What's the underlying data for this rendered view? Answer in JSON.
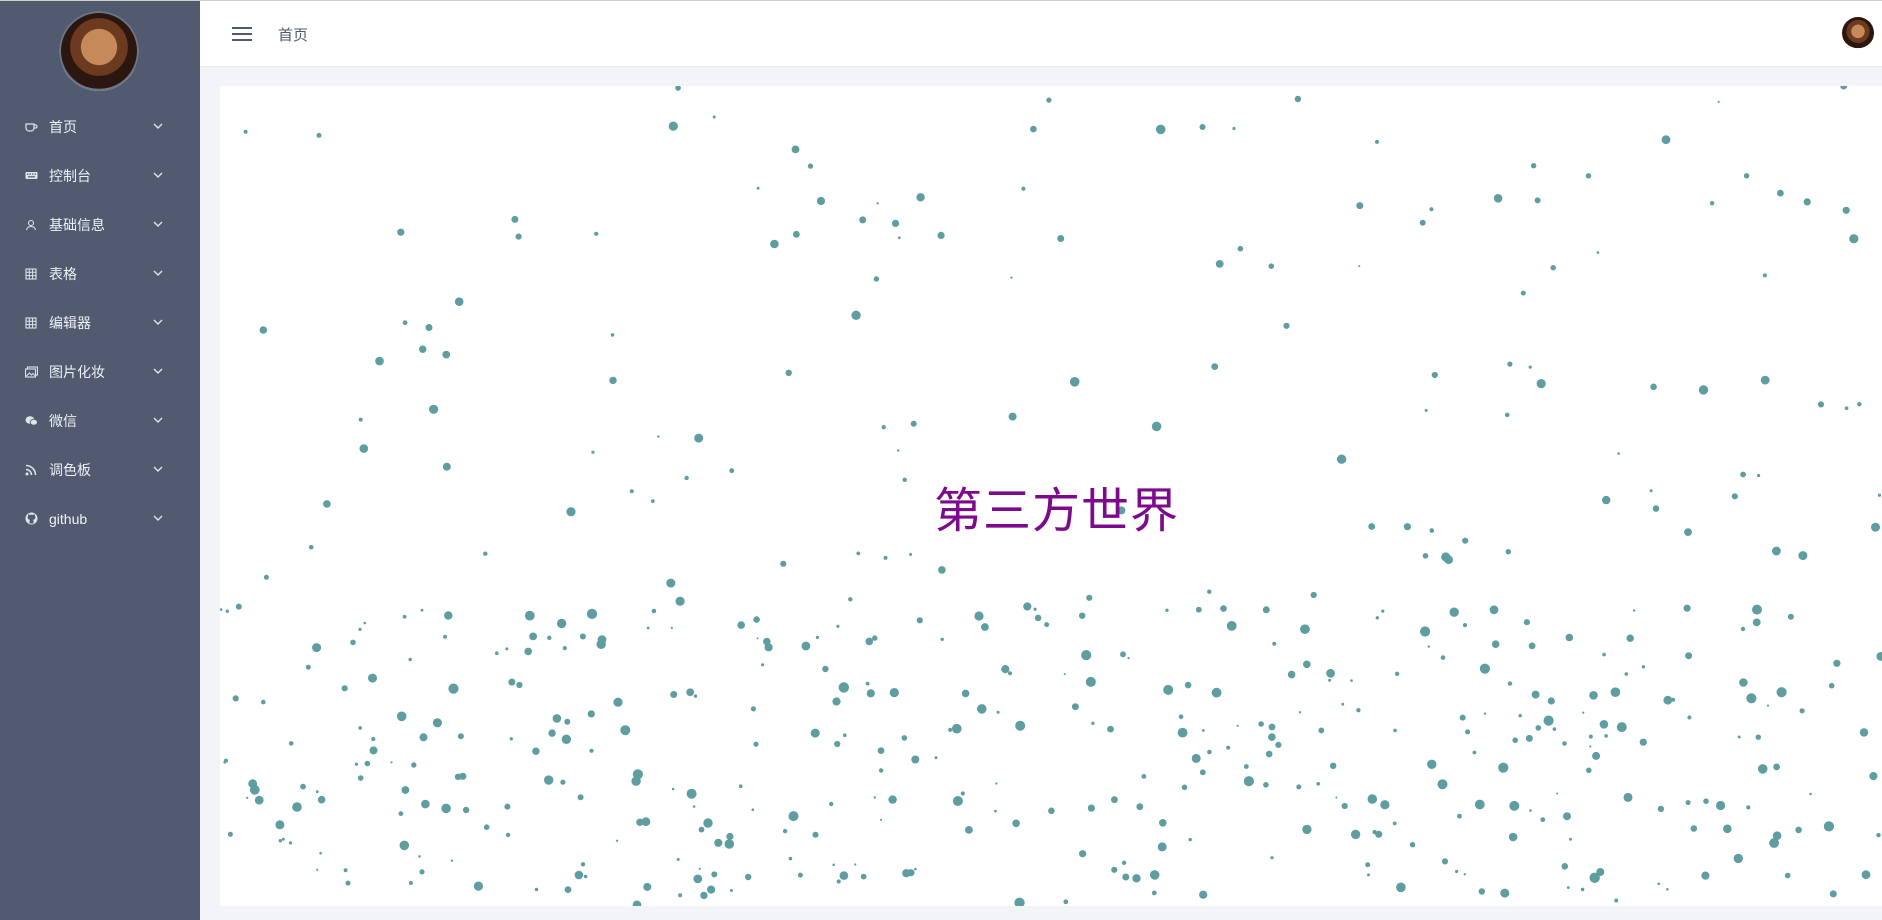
{
  "sidebar": {
    "avatar": "user-avatar",
    "items": [
      {
        "label": "首页",
        "icon": "cup-icon"
      },
      {
        "label": "控制台",
        "icon": "keyboard-icon"
      },
      {
        "label": "基础信息",
        "icon": "person-icon"
      },
      {
        "label": "表格",
        "icon": "grid-icon"
      },
      {
        "label": "编辑器",
        "icon": "grid-icon"
      },
      {
        "label": "图片化妆",
        "icon": "images-icon"
      },
      {
        "label": "微信",
        "icon": "chat-icon"
      },
      {
        "label": "调色板",
        "icon": "rss-icon"
      },
      {
        "label": "github",
        "icon": "github-icon"
      }
    ]
  },
  "header": {
    "breadcrumb": "首页"
  },
  "main": {
    "headline": "第三方世界"
  },
  "colors": {
    "sidebar_bg": "#515a6e",
    "particle": "#5f9ea0",
    "headline": "#7d0a8c"
  }
}
